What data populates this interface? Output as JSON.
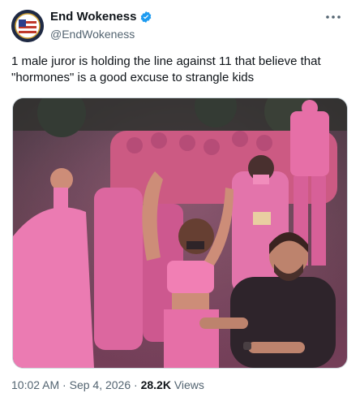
{
  "author": {
    "display_name": "End Wokeness",
    "handle": "@EndWokeness",
    "verified": true,
    "avatar_icon": "flag-badge-avatar"
  },
  "tweet": {
    "text": "1 male juror is holding the line against 11 that believe that \"hormones\" is a good excuse to strangle kids",
    "media_description_icon": "crowd-photo"
  },
  "meta": {
    "time": "10:02 AM",
    "sep1": " · ",
    "date": "Sep 4, 2026",
    "sep2": " · ",
    "views_count": "28.2K",
    "views_label": " Views"
  },
  "colors": {
    "verified_blue": "#1d9bf0",
    "pink": "#e46ea6",
    "secondary_text": "#536471"
  }
}
